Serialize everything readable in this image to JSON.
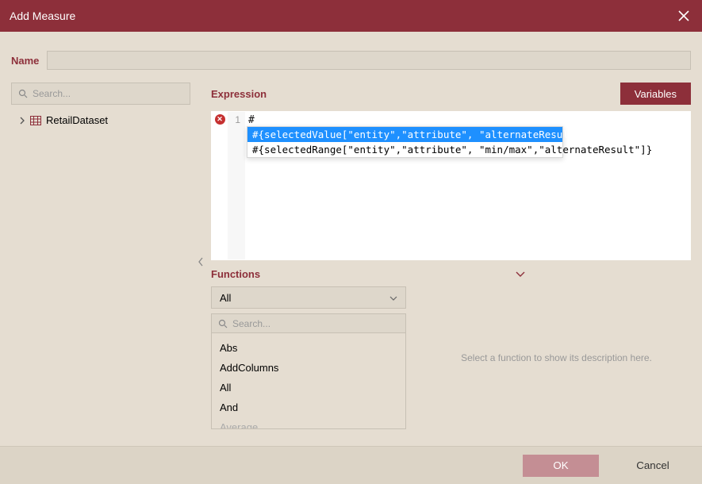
{
  "title": "Add Measure",
  "nameField": {
    "label": "Name",
    "value": ""
  },
  "searchPlaceholder": "Search...",
  "tree": {
    "item0": {
      "label": "RetailDataset"
    }
  },
  "expression": {
    "label": "Expression",
    "variablesBtn": "Variables",
    "lineNum": "1",
    "code": "#",
    "errorGlyph": "✕",
    "suggest": {
      "opt0": "#{selectedValue[\"entity\",\"attribute\", \"alternateResult\"]}",
      "opt1": "#{selectedRange[\"entity\",\"attribute\", \"min/max\",\"alternateResult\"]}"
    }
  },
  "functions": {
    "label": "Functions",
    "filter": "All",
    "searchPlaceholder": "Search...",
    "items": {
      "f0": "Abs",
      "f1": "AddColumns",
      "f2": "All",
      "f3": "And",
      "f4": "Average"
    },
    "descriptionHint": "Select a function to show its description here."
  },
  "footer": {
    "ok": "OK",
    "cancel": "Cancel"
  }
}
